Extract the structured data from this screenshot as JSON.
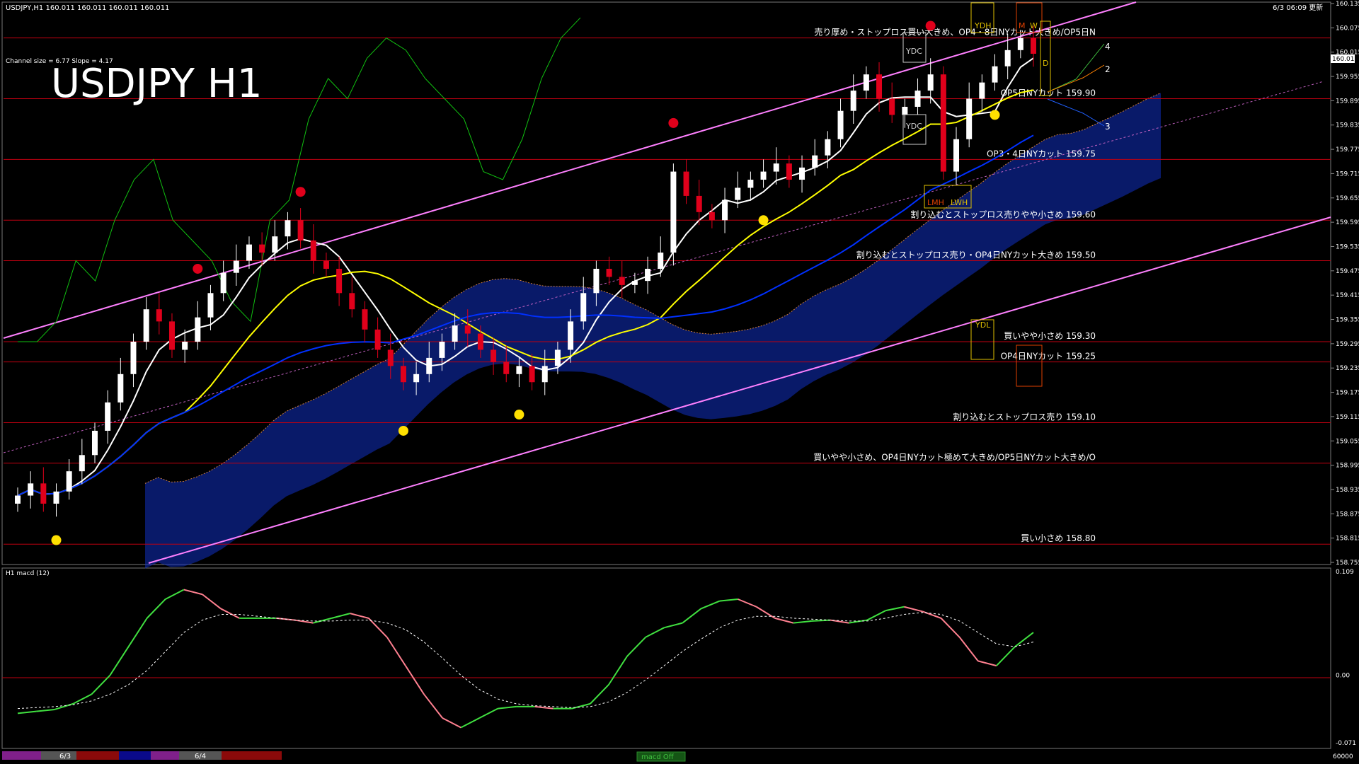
{
  "header": {
    "info": "USDJPY,H1  160.011 160.011 160.011 160.011",
    "datetime": "6/3 06:09 更新",
    "channel_info": "Channel size = 6.77 Slope = 4.17",
    "big_title": "USDJPY H1"
  },
  "colors": {
    "background": "#000000",
    "candle_up": "#ffffff",
    "candle_down": "#e0001b",
    "level_line": "#c00010",
    "channel": "#ff80ff",
    "kumo_blue": "#1030c0",
    "kumo_orange": "#d08040",
    "ma_white": "#ffffff",
    "ma_yellow": "#ffff00",
    "ma_blue": "#0030ff",
    "chikou": "#10c010",
    "macd_up": "#40e040",
    "macd_down": "#ff8090"
  },
  "chart_data": [
    {
      "type": "line",
      "panel": "price",
      "title": "USDJPY H1",
      "ylim": [
        158.755,
        160.135
      ],
      "y_ticks": [
        "160.135",
        "160.075",
        "160.015",
        "159.955",
        "159.895",
        "159.835",
        "159.775",
        "159.715",
        "159.655",
        "159.595",
        "159.535",
        "159.475",
        "159.415",
        "159.355",
        "159.295",
        "159.235",
        "159.175",
        "159.115",
        "159.055",
        "158.995",
        "158.935",
        "158.875",
        "158.815",
        "158.755"
      ],
      "current_price": "160.011",
      "series": [
        {
          "name": "close",
          "values": [
            158.92,
            158.95,
            158.9,
            158.93,
            158.98,
            159.02,
            159.08,
            159.15,
            159.22,
            159.3,
            159.38,
            159.35,
            159.28,
            159.3,
            159.36,
            159.42,
            159.47,
            159.5,
            159.54,
            159.52,
            159.56,
            159.6,
            159.55,
            159.5,
            159.48,
            159.42,
            159.38,
            159.33,
            159.28,
            159.24,
            159.2,
            159.22,
            159.26,
            159.3,
            159.34,
            159.32,
            159.28,
            159.25,
            159.22,
            159.24,
            159.2,
            159.24,
            159.28,
            159.35,
            159.42,
            159.48,
            159.46,
            159.44,
            159.45,
            159.48,
            159.52,
            159.72,
            159.66,
            159.62,
            159.6,
            159.65,
            159.68,
            159.7,
            159.72,
            159.74,
            159.7,
            159.73,
            159.76,
            159.8,
            159.87,
            159.92,
            159.96,
            159.9,
            159.86,
            159.88,
            159.92,
            159.96,
            159.72,
            159.8,
            159.9,
            159.94,
            159.98,
            160.02,
            160.05,
            160.011
          ]
        },
        {
          "name": "chikou",
          "values": [
            159.3,
            159.3,
            159.35,
            159.5,
            159.45,
            159.6,
            159.7,
            159.75,
            159.6,
            159.55,
            159.5,
            159.4,
            159.35,
            159.6,
            159.65,
            159.85,
            159.95,
            159.9,
            160.0,
            160.05,
            160.02,
            159.95,
            159.9,
            159.85,
            159.72,
            159.7,
            159.8,
            159.95,
            160.05,
            160.1
          ]
        }
      ]
    },
    {
      "type": "line",
      "panel": "macd",
      "title": "H1  macd (12)",
      "ylim": [
        -0.071,
        0.109
      ],
      "y_ticks": [
        "0.109",
        "0.00",
        "-0.071"
      ],
      "series": [
        {
          "name": "macd",
          "values": [
            -0.04,
            -0.038,
            -0.036,
            -0.03,
            -0.02,
            0.0,
            0.03,
            0.06,
            0.08,
            0.09,
            0.085,
            0.07,
            0.06,
            0.06,
            0.06,
            0.058,
            0.055,
            0.06,
            0.065,
            0.06,
            0.04,
            0.01,
            -0.02,
            -0.045,
            -0.055,
            -0.045,
            -0.035,
            -0.033,
            -0.033,
            -0.035,
            -0.035,
            -0.03,
            -0.01,
            0.02,
            0.04,
            0.05,
            0.055,
            0.07,
            0.078,
            0.08,
            0.072,
            0.06,
            0.055,
            0.057,
            0.058,
            0.055,
            0.058,
            0.068,
            0.072,
            0.067,
            0.06,
            0.04,
            0.015,
            0.01,
            0.03,
            0.045
          ]
        },
        {
          "name": "signal",
          "values": [
            -0.035,
            -0.034,
            -0.033,
            -0.031,
            -0.027,
            -0.02,
            -0.01,
            0.005,
            0.025,
            0.045,
            0.058,
            0.064,
            0.064,
            0.062,
            0.06,
            0.058,
            0.057,
            0.057,
            0.058,
            0.058,
            0.055,
            0.048,
            0.035,
            0.018,
            0.0,
            -0.015,
            -0.025,
            -0.03,
            -0.032,
            -0.033,
            -0.034,
            -0.033,
            -0.028,
            -0.018,
            -0.005,
            0.01,
            0.025,
            0.038,
            0.05,
            0.058,
            0.062,
            0.062,
            0.06,
            0.059,
            0.058,
            0.057,
            0.057,
            0.06,
            0.064,
            0.066,
            0.064,
            0.057,
            0.045,
            0.033,
            0.03,
            0.035
          ]
        }
      ]
    }
  ],
  "levels": [
    {
      "price": 160.05,
      "text": "売り厚め・ストップロス買い大きめ、OP4・8日NYカット大きめ/OP5日N"
    },
    {
      "price": 159.9,
      "text": "OP5日NYカット 159.90"
    },
    {
      "price": 159.75,
      "text": "OP3・4日NYカット 159.75"
    },
    {
      "price": 159.6,
      "text": "割り込むとストップロス売りやや小さめ 159.60"
    },
    {
      "price": 159.5,
      "text": "割り込むとストップロス売り・OP4日NYカット大きめ 159.50"
    },
    {
      "price": 159.3,
      "text": "買いやや小さめ 159.30"
    },
    {
      "price": 159.25,
      "text": "OP4日NYカット 159.25"
    },
    {
      "price": 159.1,
      "text": "割り込むとストップロス売り 159.10"
    },
    {
      "price": 159.0,
      "text": "買いやや小さめ、OP4日NYカット極めて大きめ/OP5日NYカット大きめ/O"
    },
    {
      "price": 158.8,
      "text": "買い小さめ 158.80"
    }
  ],
  "box_labels": {
    "ydh": "YDH",
    "ydc": "YDC",
    "ydl": "YDL",
    "lmh": "LMH",
    "lwh": "LWH",
    "m": "M",
    "w": "W",
    "d": "D"
  },
  "projection_labels": [
    "4",
    "2",
    "3"
  ],
  "timeline": {
    "labels": [
      "6/3",
      "6/4"
    ],
    "macd_button": "macd Off",
    "volume": "60000"
  }
}
